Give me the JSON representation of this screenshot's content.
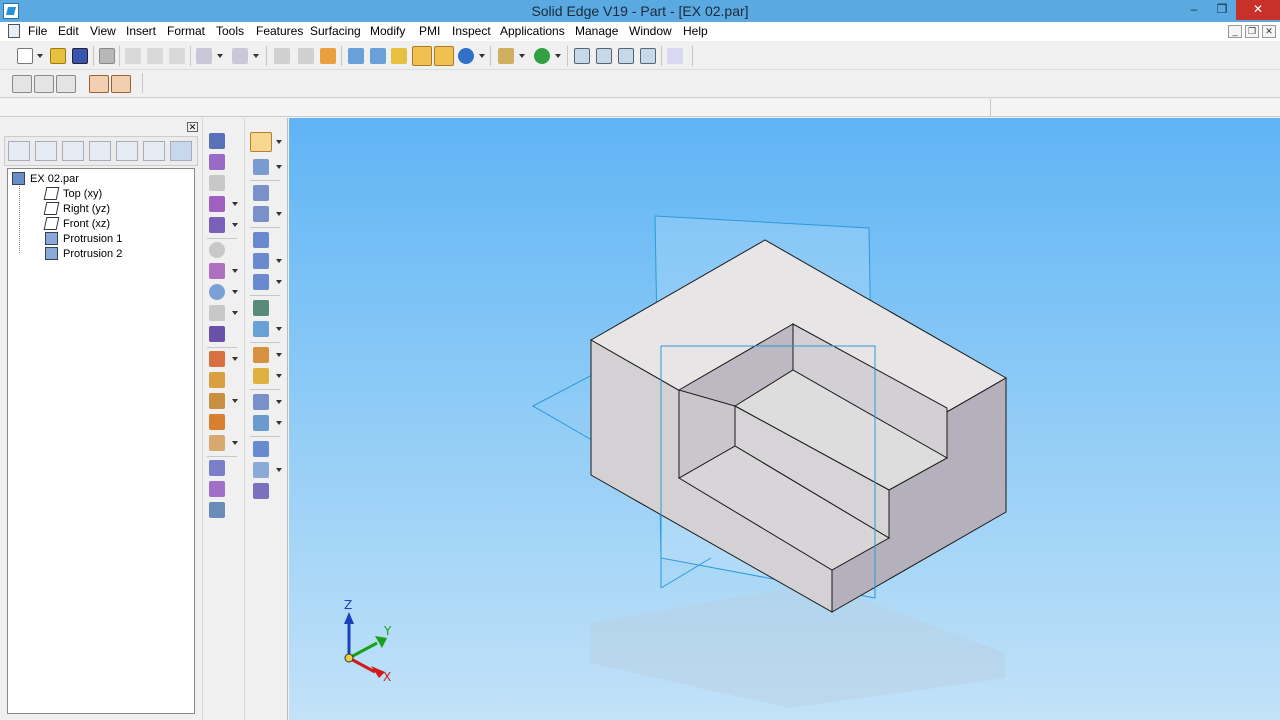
{
  "window": {
    "title": "Solid Edge V19 - Part - [EX 02.par]",
    "min_glyph": "–",
    "max_glyph": "❒",
    "close_glyph": "✕"
  },
  "menu": {
    "items": [
      "File",
      "Edit",
      "View",
      "Insert",
      "Format",
      "Tools",
      "Features",
      "Surfacing",
      "Modify",
      "PMI",
      "Inspect",
      "Applications",
      "Manage",
      "Window",
      "Help"
    ]
  },
  "mdi": {
    "min_glyph": "_",
    "restore_glyph": "❒",
    "close_glyph": "✕"
  },
  "pathfinder": {
    "close_glyph": "✕",
    "tree": [
      {
        "label": "EX 02.par",
        "icon": "part-icon"
      },
      {
        "label": "Top (xy)",
        "icon": "plane-icon"
      },
      {
        "label": "Right (yz)",
        "icon": "plane-icon"
      },
      {
        "label": "Front (xz)",
        "icon": "plane-icon"
      },
      {
        "label": "Protrusion 1",
        "icon": "protrusion-icon"
      },
      {
        "label": "Protrusion 2",
        "icon": "protrusion-icon"
      }
    ]
  },
  "triad": {
    "z_label": "Z",
    "y_label": "Y",
    "x_label": "X",
    "colors": {
      "z": "#1a3fbf",
      "y": "#18a018",
      "x": "#d01a1a"
    }
  },
  "colors": {
    "titlebar": "#5aa9e1",
    "plane": "#2b9ad8",
    "part_edge": "#1a1a1a"
  }
}
